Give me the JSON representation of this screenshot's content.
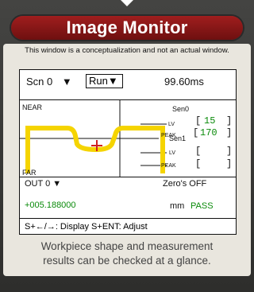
{
  "title": "Image Monitor",
  "note": "This window is a conceptualization and not an actual window.",
  "screen": {
    "scene": "Scn 0",
    "scene_arrow": "▼",
    "mode": "Run▼",
    "time": "99.60ms",
    "near_label": "NEAR",
    "far_label": "FAR",
    "sen0_label": "Sen0",
    "sen1_label": "Sen1",
    "lv_label": "LV",
    "peak_label": "PEAK",
    "sen0_lv": "15",
    "sen0_peak": "170",
    "out_label": "OUT 0 ▼",
    "zero_status": "Zero's OFF",
    "measurement": "+005.188000",
    "unit": "mm",
    "judgement": "PASS",
    "help": "S+←/→: Display S+ENT: Adjust"
  },
  "caption_line1": "Workpiece shape and measurement",
  "caption_line2": "results can be checked at a glance.",
  "colors": {
    "title_bg": "#8b1a1a",
    "profile": "#f5d400",
    "cursor": "#d02020",
    "ok_green": "#0a8a0a"
  }
}
